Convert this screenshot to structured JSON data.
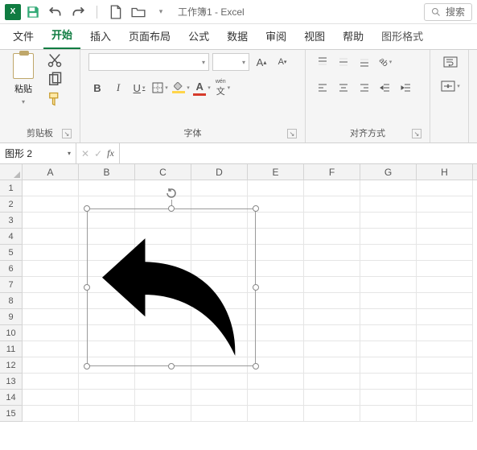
{
  "titlebar": {
    "app_icon_text": "X",
    "doc_title": "工作簿1 - Excel",
    "search_placeholder": "搜索"
  },
  "tabs": {
    "items": [
      "文件",
      "开始",
      "插入",
      "页面布局",
      "公式",
      "数据",
      "审阅",
      "视图",
      "帮助",
      "图形格式"
    ],
    "active_index": 1,
    "contextual_index": 9
  },
  "ribbon": {
    "clipboard": {
      "paste_label": "粘贴",
      "group_label": "剪贴板"
    },
    "font": {
      "font_name": "",
      "font_size": "",
      "group_label": "字体",
      "wen_label": "wén"
    },
    "align": {
      "group_label": "对齐方式"
    }
  },
  "formula_bar": {
    "name_box": "图形 2",
    "cancel": "✕",
    "enter": "✓",
    "fx": "fx",
    "formula": ""
  },
  "grid": {
    "columns": [
      "A",
      "B",
      "C",
      "D",
      "E",
      "F",
      "G",
      "H"
    ],
    "rows": [
      "1",
      "2",
      "3",
      "4",
      "5",
      "6",
      "7",
      "8",
      "9",
      "10",
      "11",
      "12",
      "13",
      "14",
      "15"
    ]
  },
  "shape": {
    "name": "curved-left-arrow"
  }
}
